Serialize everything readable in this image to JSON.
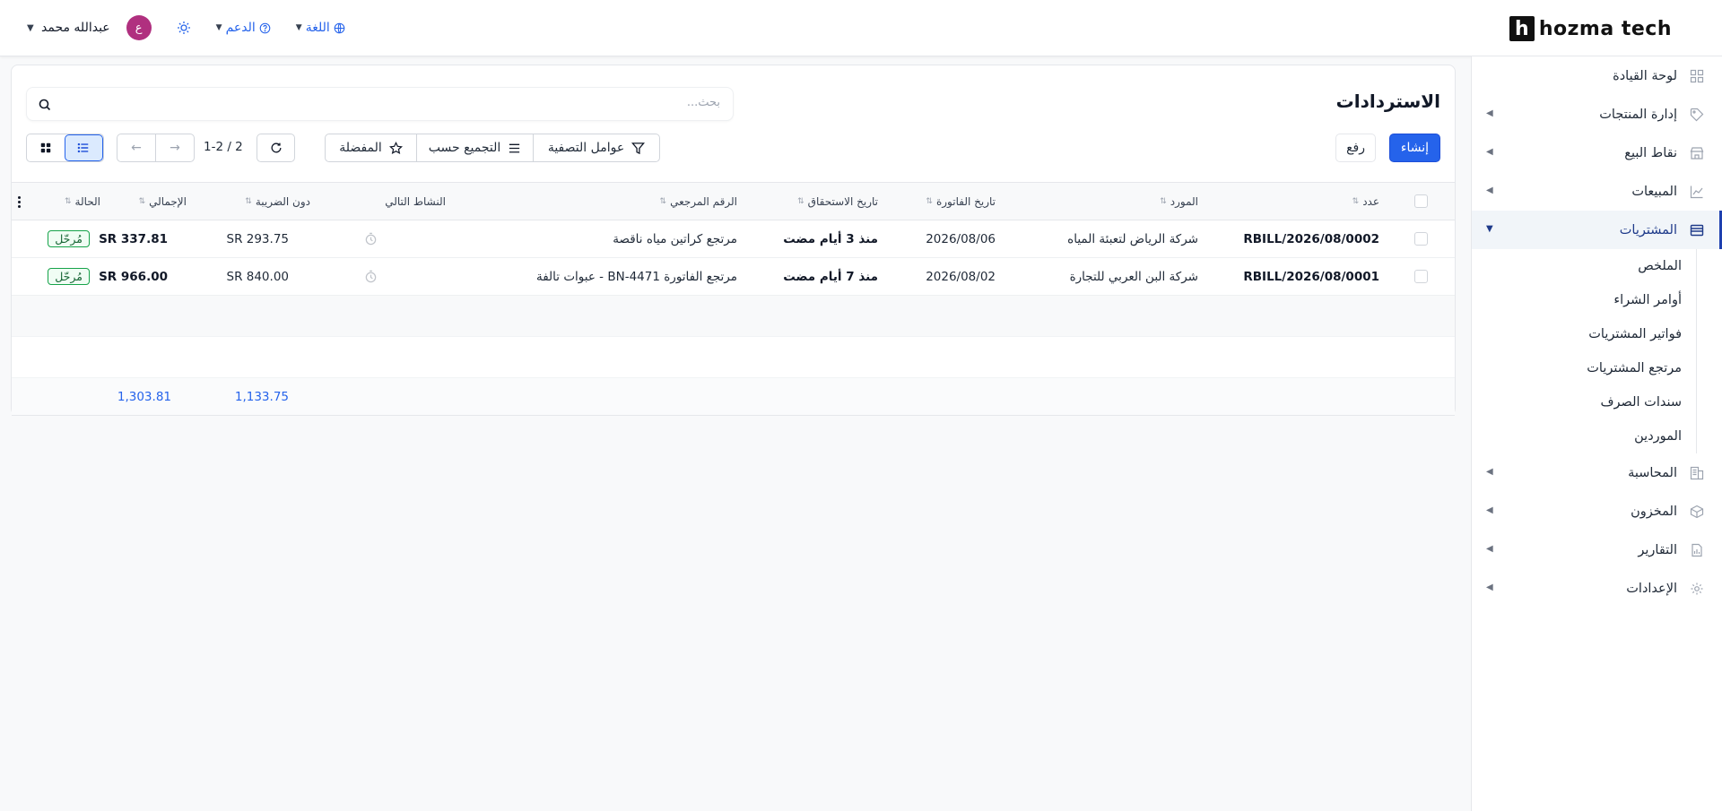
{
  "brand": {
    "mark": "h",
    "name": "hozma tech"
  },
  "topbar": {
    "user_name": "عبدالله محمد",
    "avatar_letter": "ع",
    "support_label": "الدعم",
    "language_label": "اللغة"
  },
  "sidebar": {
    "items": [
      {
        "label": "لوحة القيادة",
        "icon": "dashboard-icon"
      },
      {
        "label": "إدارة المنتجات",
        "icon": "tag-icon"
      },
      {
        "label": "نقاط البيع",
        "icon": "store-icon"
      },
      {
        "label": "المبيعات",
        "icon": "chart-icon"
      },
      {
        "label": "المشتريات",
        "icon": "wallet-icon"
      },
      {
        "label": "المحاسبة",
        "icon": "ledger-icon"
      },
      {
        "label": "المخزون",
        "icon": "box-icon"
      },
      {
        "label": "التقارير",
        "icon": "report-icon"
      },
      {
        "label": "الإعدادات",
        "icon": "gear-icon"
      }
    ],
    "purchases_sub": [
      "الملخص",
      "أوامر الشراء",
      "فواتير المشتريات",
      "مرتجع المشتريات",
      "سندات الصرف",
      "الموردين"
    ]
  },
  "page": {
    "title": "الاستردادات",
    "search_placeholder": "بحث...",
    "create_label": "إنشاء",
    "upload_label": "رفع",
    "filters_label": "عوامل التصفية",
    "group_by_label": "التجميع حسب",
    "favorites_label": "المفضلة",
    "pager_text": "1-2 / 2"
  },
  "table": {
    "headers": {
      "number": "عدد",
      "vendor": "المورد",
      "invoice_date": "تاريخ الفاتورة",
      "due_date": "تاريخ الاستحقاق",
      "reference": "الرقم المرجعي",
      "next_activity": "النشاط التالي",
      "untaxed": "دون الضريبة",
      "total": "الإجمالي",
      "status": "الحالة"
    },
    "rows": [
      {
        "number": "RBILL/2026/08/0002",
        "vendor": "شركة الرياض لتعبئة المياه",
        "invoice_date": "2026/08/06",
        "due_date": "منذ 3 أيام مضت",
        "reference": "مرتجع كراتين مياه ناقصة",
        "untaxed": "SR 293.75",
        "total": "SR 337.81",
        "status": "مُرحّل"
      },
      {
        "number": "RBILL/2026/08/0001",
        "vendor": "شركة البن العربي للتجارة",
        "invoice_date": "2026/08/02",
        "due_date": "منذ 7 أيام مضت",
        "reference": "مرتجع الفاتورة BN-4471 - عبوات تالفة",
        "untaxed": "SR 840.00",
        "total": "SR 966.00",
        "status": "مُرحّل"
      }
    ],
    "totals": {
      "untaxed": "1,133.75",
      "total": "1,303.81"
    }
  },
  "colors": {
    "primary": "#2563eb",
    "avatar": "#b0307f",
    "posted_badge": "#16a34a"
  }
}
